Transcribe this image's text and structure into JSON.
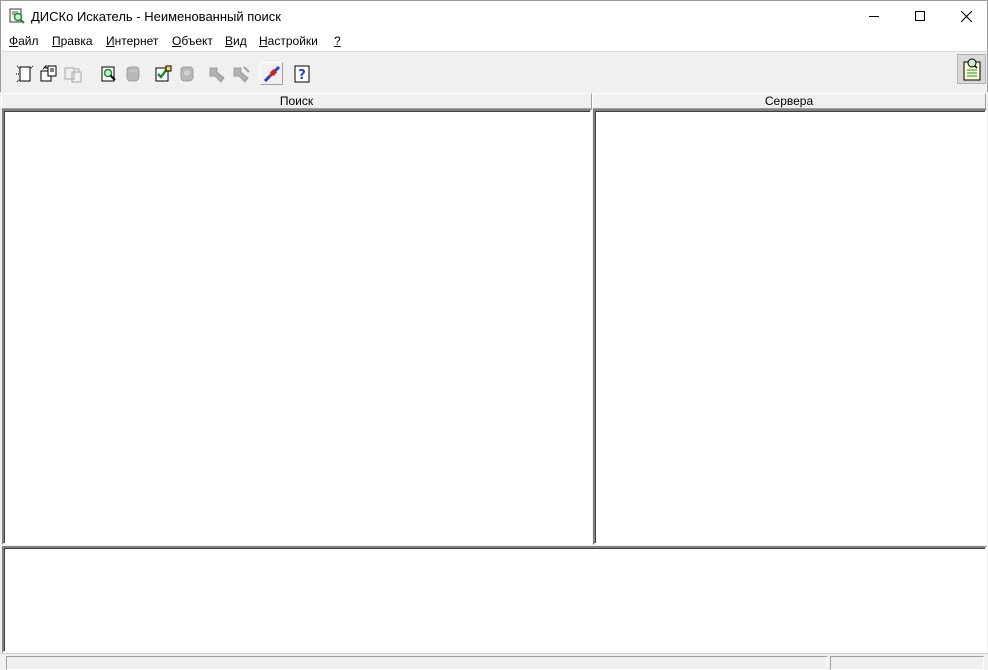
{
  "window": {
    "title": "ДИСКо Искатель - Неименованный поиск",
    "icon": "magnifier-document-icon"
  },
  "menu": [
    {
      "hotkey": "Ф",
      "rest": "айл"
    },
    {
      "hotkey": "П",
      "rest": "равка"
    },
    {
      "hotkey": "И",
      "rest": "нтернет"
    },
    {
      "hotkey": "О",
      "rest": "бъект"
    },
    {
      "hotkey": "В",
      "rest": "ид"
    },
    {
      "hotkey": "Н",
      "rest": "астройки"
    },
    {
      "hotkey": "?",
      "rest": ""
    }
  ],
  "toolbar": {
    "buttons": [
      {
        "icon": "new-search-icon",
        "enabled": true
      },
      {
        "icon": "open-search-icon",
        "enabled": true
      },
      {
        "icon": "save-search-icon",
        "enabled": false
      },
      {
        "icon": "find-object-icon",
        "enabled": true
      },
      {
        "icon": "stop-search-icon",
        "enabled": false
      },
      {
        "icon": "check-object-icon",
        "enabled": true
      },
      {
        "icon": "object-properties-icon",
        "enabled": false
      },
      {
        "icon": "network-tool-icon",
        "enabled": false
      },
      {
        "icon": "network-tool-2-icon",
        "enabled": false
      },
      {
        "icon": "connect-plug-icon",
        "enabled": true
      },
      {
        "icon": "help-icon",
        "enabled": true
      }
    ],
    "right_icon": "notes-clipboard-icon"
  },
  "panes": {
    "search_header": "Поиск",
    "servers_header": "Сервера"
  },
  "status": {
    "main": "",
    "side": ""
  },
  "colors": {
    "accent_green": "#1a8c3a",
    "accent_blue": "#1f3fd6",
    "accent_red": "#d81e1e",
    "disabled_gray": "#a8a8a8"
  }
}
